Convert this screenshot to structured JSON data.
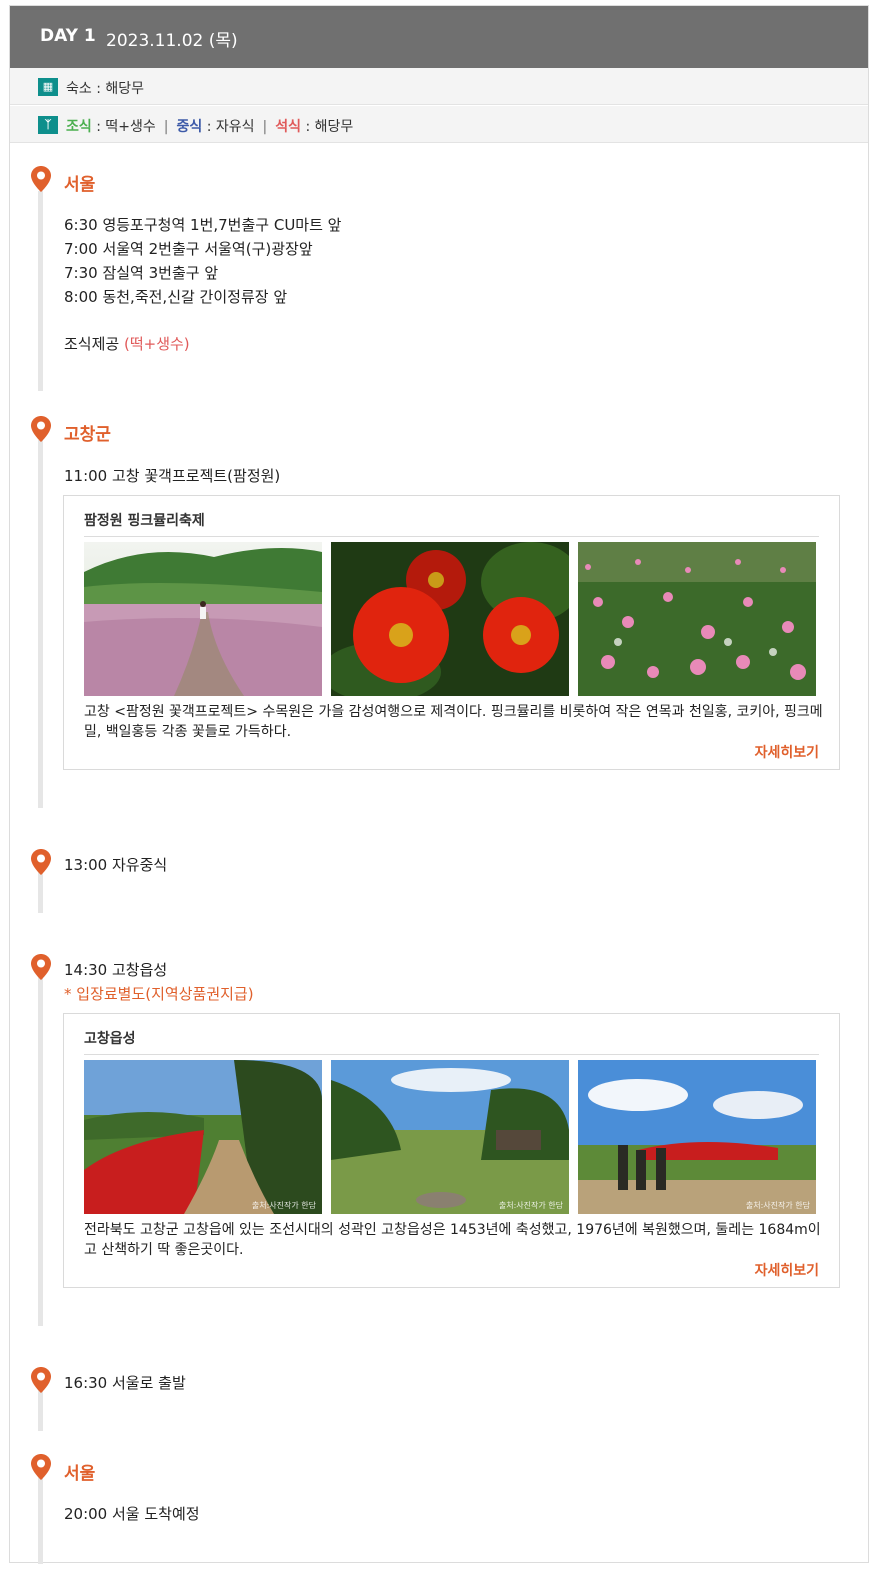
{
  "day": {
    "label": "DAY 1",
    "date": "2023.11.02 (목)"
  },
  "lodging": {
    "icon": "building-icon",
    "text": "숙소 : 해당무"
  },
  "meals": {
    "icon": "fork-knife-icon",
    "breakfast_label": "조식",
    "breakfast_value": " : 떡+생수",
    "lunch_label": "중식",
    "lunch_value": " : 자유식",
    "dinner_label": "석식",
    "dinner_value": " : 해당무",
    "separator": "|"
  },
  "colors": {
    "header_bg": "#707070",
    "accent": "#e0602c",
    "teal": "#0e8f8c",
    "breakfast": "#4caf50",
    "lunch": "#3d5aa8",
    "dinner": "#e05a5a"
  },
  "stops": [
    {
      "title": "서울",
      "lines": [
        "6:30 영등포구청역 1번,7번출구 CU마트 앞",
        "7:00 서울역 2번출구 서울역(구)광장앞",
        "7:30 잠실역 3번출구 앞",
        "8:00 동천,죽전,신갈 간이정류장 앞"
      ],
      "note_prefix": "조식제공 ",
      "note_highlight": "(떡+생수)"
    },
    {
      "title": "고창군",
      "lines": [
        "11:00 고창 꽃객프로젝트(팜정원)"
      ],
      "card": {
        "title": "팜정원 핑크뮬리축제",
        "photos": [
          "pink-muhly-field-photo",
          "red-zinnia-photo",
          "zinnia-field-photo"
        ],
        "description": "고창 <팜정원 꽃객프로젝트> 수목원은 가을 감성여행으로 제격이다. 핑크뮬리를 비롯하여 작은 연목과 천일홍, 코키아, 핑크메밀, 백일홍등 각종 꽃들로 가득하다.",
        "more": "자세히보기"
      }
    },
    {
      "lines": [
        "13:00 자유중식"
      ]
    },
    {
      "lines": [
        "14:30 고창읍성"
      ],
      "notice": "* 입장료별도(지역상품권지급)",
      "card": {
        "title": "고창읍성",
        "photos": [
          "fortress-path-photo",
          "fortress-garden-photo",
          "fortress-statues-photo"
        ],
        "photo_caption": "출처:사진작가 한담",
        "description": "전라북도 고창군 고창읍에 있는 조선시대의 성곽인 고창읍성은 1453년에 축성했고, 1976년에 복원했으며, 둘레는 1684m이고 산책하기 딱 좋은곳이다.",
        "more": "자세히보기"
      }
    },
    {
      "lines": [
        "16:30 서울로 출발"
      ]
    },
    {
      "title": "서울",
      "lines": [
        "20:00 서울 도착예정"
      ]
    }
  ]
}
